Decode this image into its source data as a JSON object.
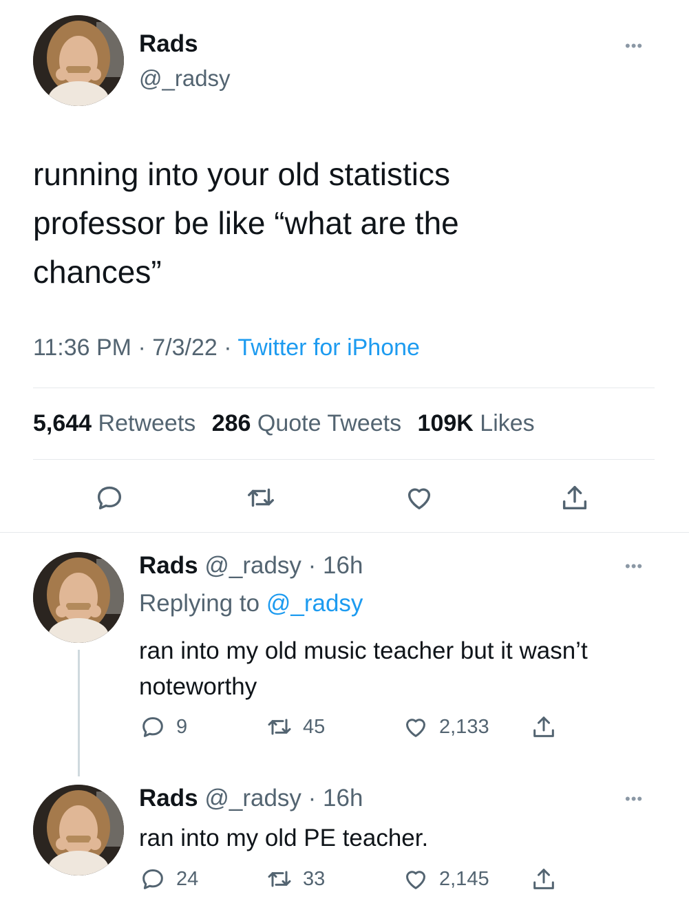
{
  "main_tweet": {
    "author_name": "Rads",
    "author_handle": "@_radsy",
    "text_lines": [
      "running into your old statistics",
      "professor be like “what are the",
      "chances”"
    ],
    "time": "11:36 PM",
    "date": "7/3/22",
    "source": "Twitter for iPhone",
    "stats": {
      "retweets_count": "5,644",
      "retweets_label": "Retweets",
      "quotes_count": "286",
      "quotes_label": "Quote Tweets",
      "likes_count": "109K",
      "likes_label": "Likes"
    },
    "icons": [
      "reply-icon",
      "retweet-icon",
      "like-icon",
      "share-icon"
    ]
  },
  "replies": [
    {
      "author_name": "Rads",
      "author_handle": "@_radsy",
      "age": "16h",
      "replying_to_label": "Replying to",
      "replying_to_handle": "@_radsy",
      "text_lines": [
        "ran into my old music teacher but it wasn’t",
        "noteworthy"
      ],
      "reply_count": "9",
      "retweet_count": "45",
      "like_count": "2,133"
    },
    {
      "author_name": "Rads",
      "author_handle": "@_radsy",
      "age": "16h",
      "text_lines": [
        "ran into my old PE teacher."
      ],
      "reply_count": "24",
      "retweet_count": "33",
      "like_count": "2,145"
    }
  ],
  "colors": {
    "text": "#0f1419",
    "muted": "#536471",
    "link": "#1d9bf0",
    "divider": "#e6e9ec"
  }
}
